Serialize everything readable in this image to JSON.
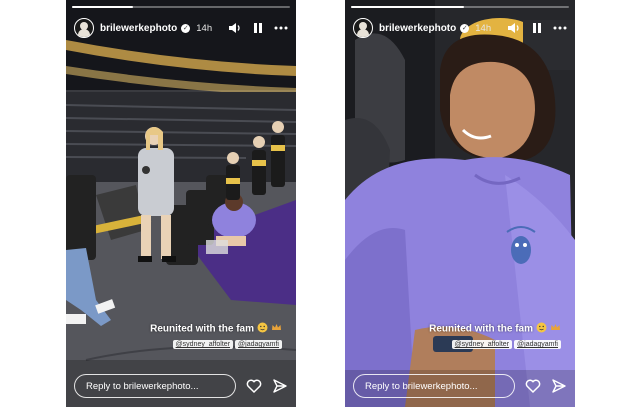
{
  "stories": [
    {
      "username": "brilewerkephoto",
      "verified": true,
      "time": "14h",
      "progress_fraction": 0.28,
      "caption": "Reunited with the fam",
      "caption_emojis": [
        "smiling-with-tear-emoji",
        "crown-emoji"
      ],
      "tags": [
        "@sydney_affolter",
        "@jadagyamfi"
      ],
      "reply_placeholder": "Reply to brilewerkephoto...",
      "icons": [
        "volume-icon",
        "pause-icon",
        "more-icon",
        "heart-icon",
        "send-icon"
      ]
    },
    {
      "username": "brilewerkephoto",
      "verified": true,
      "time": "14h",
      "progress_fraction": 0.52,
      "caption": "Reunited with the fam",
      "caption_emojis": [
        "smiling-with-tear-emoji",
        "crown-emoji"
      ],
      "tags": [
        "@sydney_affolter",
        "@jadagyamfi"
      ],
      "reply_placeholder": "Reply to brilewerkephoto...",
      "icons": [
        "volume-icon",
        "pause-icon",
        "more-icon",
        "heart-icon",
        "send-icon"
      ]
    }
  ],
  "colors": {
    "arena_seat_gray": "#2f3034",
    "hoodie_lavender": "#8f82dd",
    "court_purple": "#5a3aa0",
    "tunnel_gold": "#e3b341"
  }
}
